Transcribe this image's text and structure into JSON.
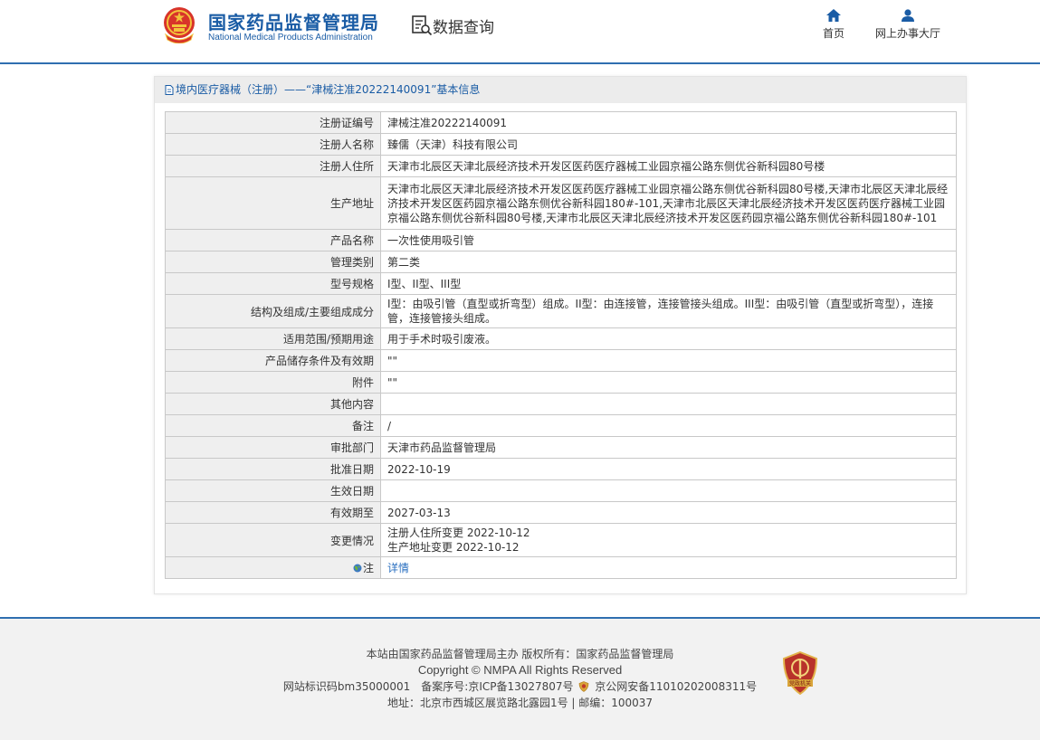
{
  "header": {
    "org_name_cn": "国家药品监督管理局",
    "org_name_en": "National Medical Products Administration",
    "data_query": "数据查询",
    "nav": {
      "home": "首页",
      "online_hall": "网上办事大厅"
    }
  },
  "panel": {
    "title": "境内医疗器械（注册）——“津械注准20222140091”基本信息",
    "rows": [
      {
        "label": "注册证编号",
        "value": "津械注准20222140091"
      },
      {
        "label": "注册人名称",
        "value": "臻儒（天津）科技有限公司"
      },
      {
        "label": "注册人住所",
        "value": "天津市北辰区天津北辰经济技术开发区医药医疗器械工业园京福公路东侧优谷新科园80号楼"
      },
      {
        "label": "生产地址",
        "value": "天津市北辰区天津北辰经济技术开发区医药医疗器械工业园京福公路东侧优谷新科园80号楼,天津市北辰区天津北辰经济技术开发区医药园京福公路东侧优谷新科园180#-101,天津市北辰区天津北辰经济技术开发区医药医疗器械工业园京福公路东侧优谷新科园80号楼,天津市北辰区天津北辰经济技术开发区医药园京福公路东侧优谷新科园180#-101"
      },
      {
        "label": "产品名称",
        "value": "一次性使用吸引管"
      },
      {
        "label": "管理类别",
        "value": "第二类"
      },
      {
        "label": "型号规格",
        "value": "I型、II型、III型"
      },
      {
        "label": "结构及组成/主要组成成分",
        "value": "I型：由吸引管（直型或折弯型）组成。II型：由连接管，连接管接头组成。III型：由吸引管（直型或折弯型），连接管，连接管接头组成。"
      },
      {
        "label": "适用范围/预期用途",
        "value": "用于手术时吸引废液。"
      },
      {
        "label": "产品储存条件及有效期",
        "value": "\"\""
      },
      {
        "label": "附件",
        "value": "\"\""
      },
      {
        "label": "其他内容",
        "value": ""
      },
      {
        "label": "备注",
        "value": "/"
      },
      {
        "label": "审批部门",
        "value": "天津市药品监督管理局"
      },
      {
        "label": "批准日期",
        "value": "2022-10-19"
      },
      {
        "label": "生效日期",
        "value": ""
      },
      {
        "label": "有效期至",
        "value": "2027-03-13"
      }
    ],
    "changes": {
      "label": "变更情况",
      "line1": "注册人住所变更 2022-10-12",
      "line2": "生产地址变更 2022-10-12"
    },
    "note": {
      "label": "注",
      "link": "详情"
    }
  },
  "footer": {
    "line1": "本站由国家药品监督管理局主办 版权所有：国家药品监督管理局",
    "line2": "Copyright © NMPA All Rights Reserved",
    "line3a": "网站标识码bm35000001　备案序号:京ICP备13027807号",
    "line3b": "京公网安备11010202008311号",
    "line4": "地址：北京市西城区展览路北露园1号 | 邮编：100037",
    "badge_text": "党政机关"
  },
  "colors": {
    "brand_blue": "#1a5ca5",
    "link_blue": "#2a6fc0",
    "header_rule": "#2f6fb0",
    "badge_red": "#c0392b"
  },
  "icons": [
    "national-emblem-icon",
    "data-query-icon",
    "home-icon",
    "user-icon",
    "document-icon",
    "globe-icon",
    "police-badge-icon",
    "party-government-badge-icon"
  ]
}
